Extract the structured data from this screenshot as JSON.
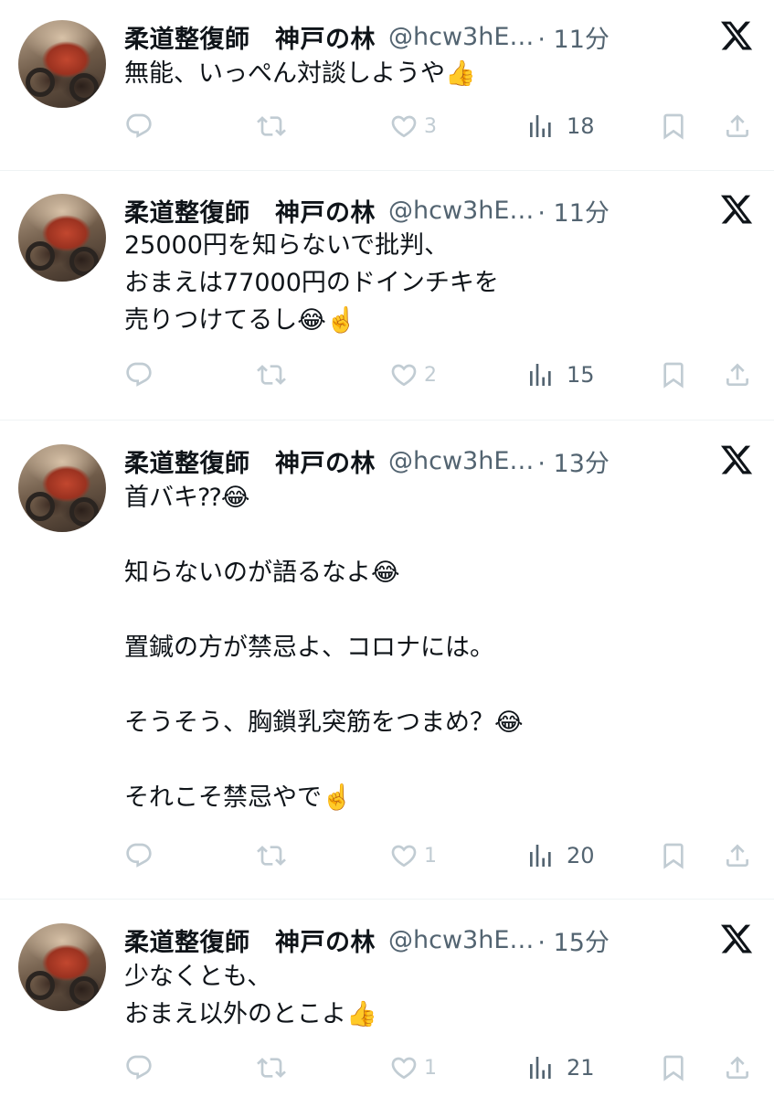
{
  "app": {
    "name": "X",
    "logo_icon": "x-logo-icon"
  },
  "colors": {
    "text": "#0f1419",
    "secondary": "#536471",
    "muted_icon": "#c1ccd3",
    "divider": "#eff3f4"
  },
  "tweets": [
    {
      "display_name": "柔道整復師　神戸の林",
      "handle": "@hcw3hE…",
      "time": "· 11分",
      "text": "無能、いっぺん対談しようや👍",
      "replies": "",
      "retweets": "",
      "likes": "3",
      "views": "18"
    },
    {
      "display_name": "柔道整復師　神戸の林",
      "handle": "@hcw3hE…",
      "time": "· 11分",
      "text": "25000円を知らないで批判、\nおまえは77000円のドインチキを\n売りつけてるし😂☝️",
      "replies": "",
      "retweets": "",
      "likes": "2",
      "views": "15"
    },
    {
      "display_name": "柔道整復師　神戸の林",
      "handle": "@hcw3hE…",
      "time": "· 13分",
      "text": "首バキ⁇😂\n\n知らないのが語るなよ😂\n\n置鍼の方が禁忌よ、コロナには。\n\nそうそう、胸鎖乳突筋をつまめ？😂\n\nそれこそ禁忌やで☝️",
      "replies": "",
      "retweets": "",
      "likes": "1",
      "views": "20"
    },
    {
      "display_name": "柔道整復師　神戸の林",
      "handle": "@hcw3hE…",
      "time": "· 15分",
      "text": "少なくとも、\nおまえ以外のとこよ👍",
      "replies": "",
      "retweets": "",
      "likes": "1",
      "views": "21"
    }
  ]
}
